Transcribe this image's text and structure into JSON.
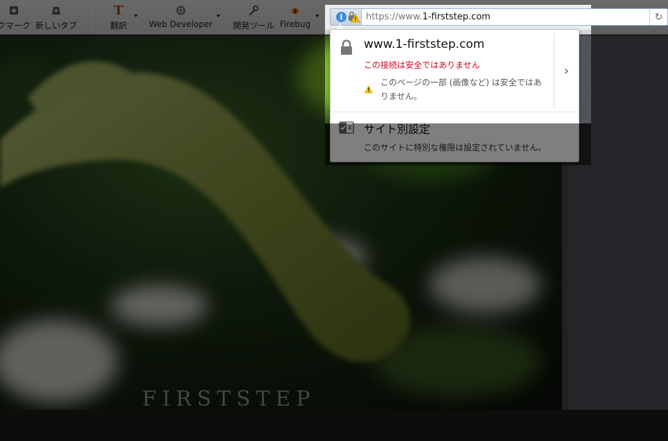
{
  "toolbar": {
    "items": [
      {
        "label": "クマーク",
        "icon": "star-icon"
      },
      {
        "label": "新しいタブ",
        "icon": "new-tab-icon"
      },
      {
        "label": "翻訳",
        "icon": "translate-icon"
      },
      {
        "label": "Web Developer",
        "icon": "gear-icon"
      },
      {
        "label": "開発ツール",
        "icon": "wrench-icon"
      },
      {
        "label": "Firebug",
        "icon": "bug-icon"
      }
    ]
  },
  "urlbar": {
    "prefix": "https://www.",
    "domain": "1-firststep.com",
    "reload_icon": "reload-icon"
  },
  "popup": {
    "host": "www.1-firststep.com",
    "status": "この接続は安全ではありません",
    "mixed_content": "このページの一部 (画像など) は安全ではありません。",
    "permissions_title": "サイト別設定",
    "permissions_desc": "このサイトに特別な権限は設定されていません。"
  },
  "page": {
    "brand": "FIRSTSTEP"
  },
  "colors": {
    "insecure_red": "#d70022",
    "info_blue": "#3d8bd9",
    "warning_yellow": "#f1c40f"
  }
}
